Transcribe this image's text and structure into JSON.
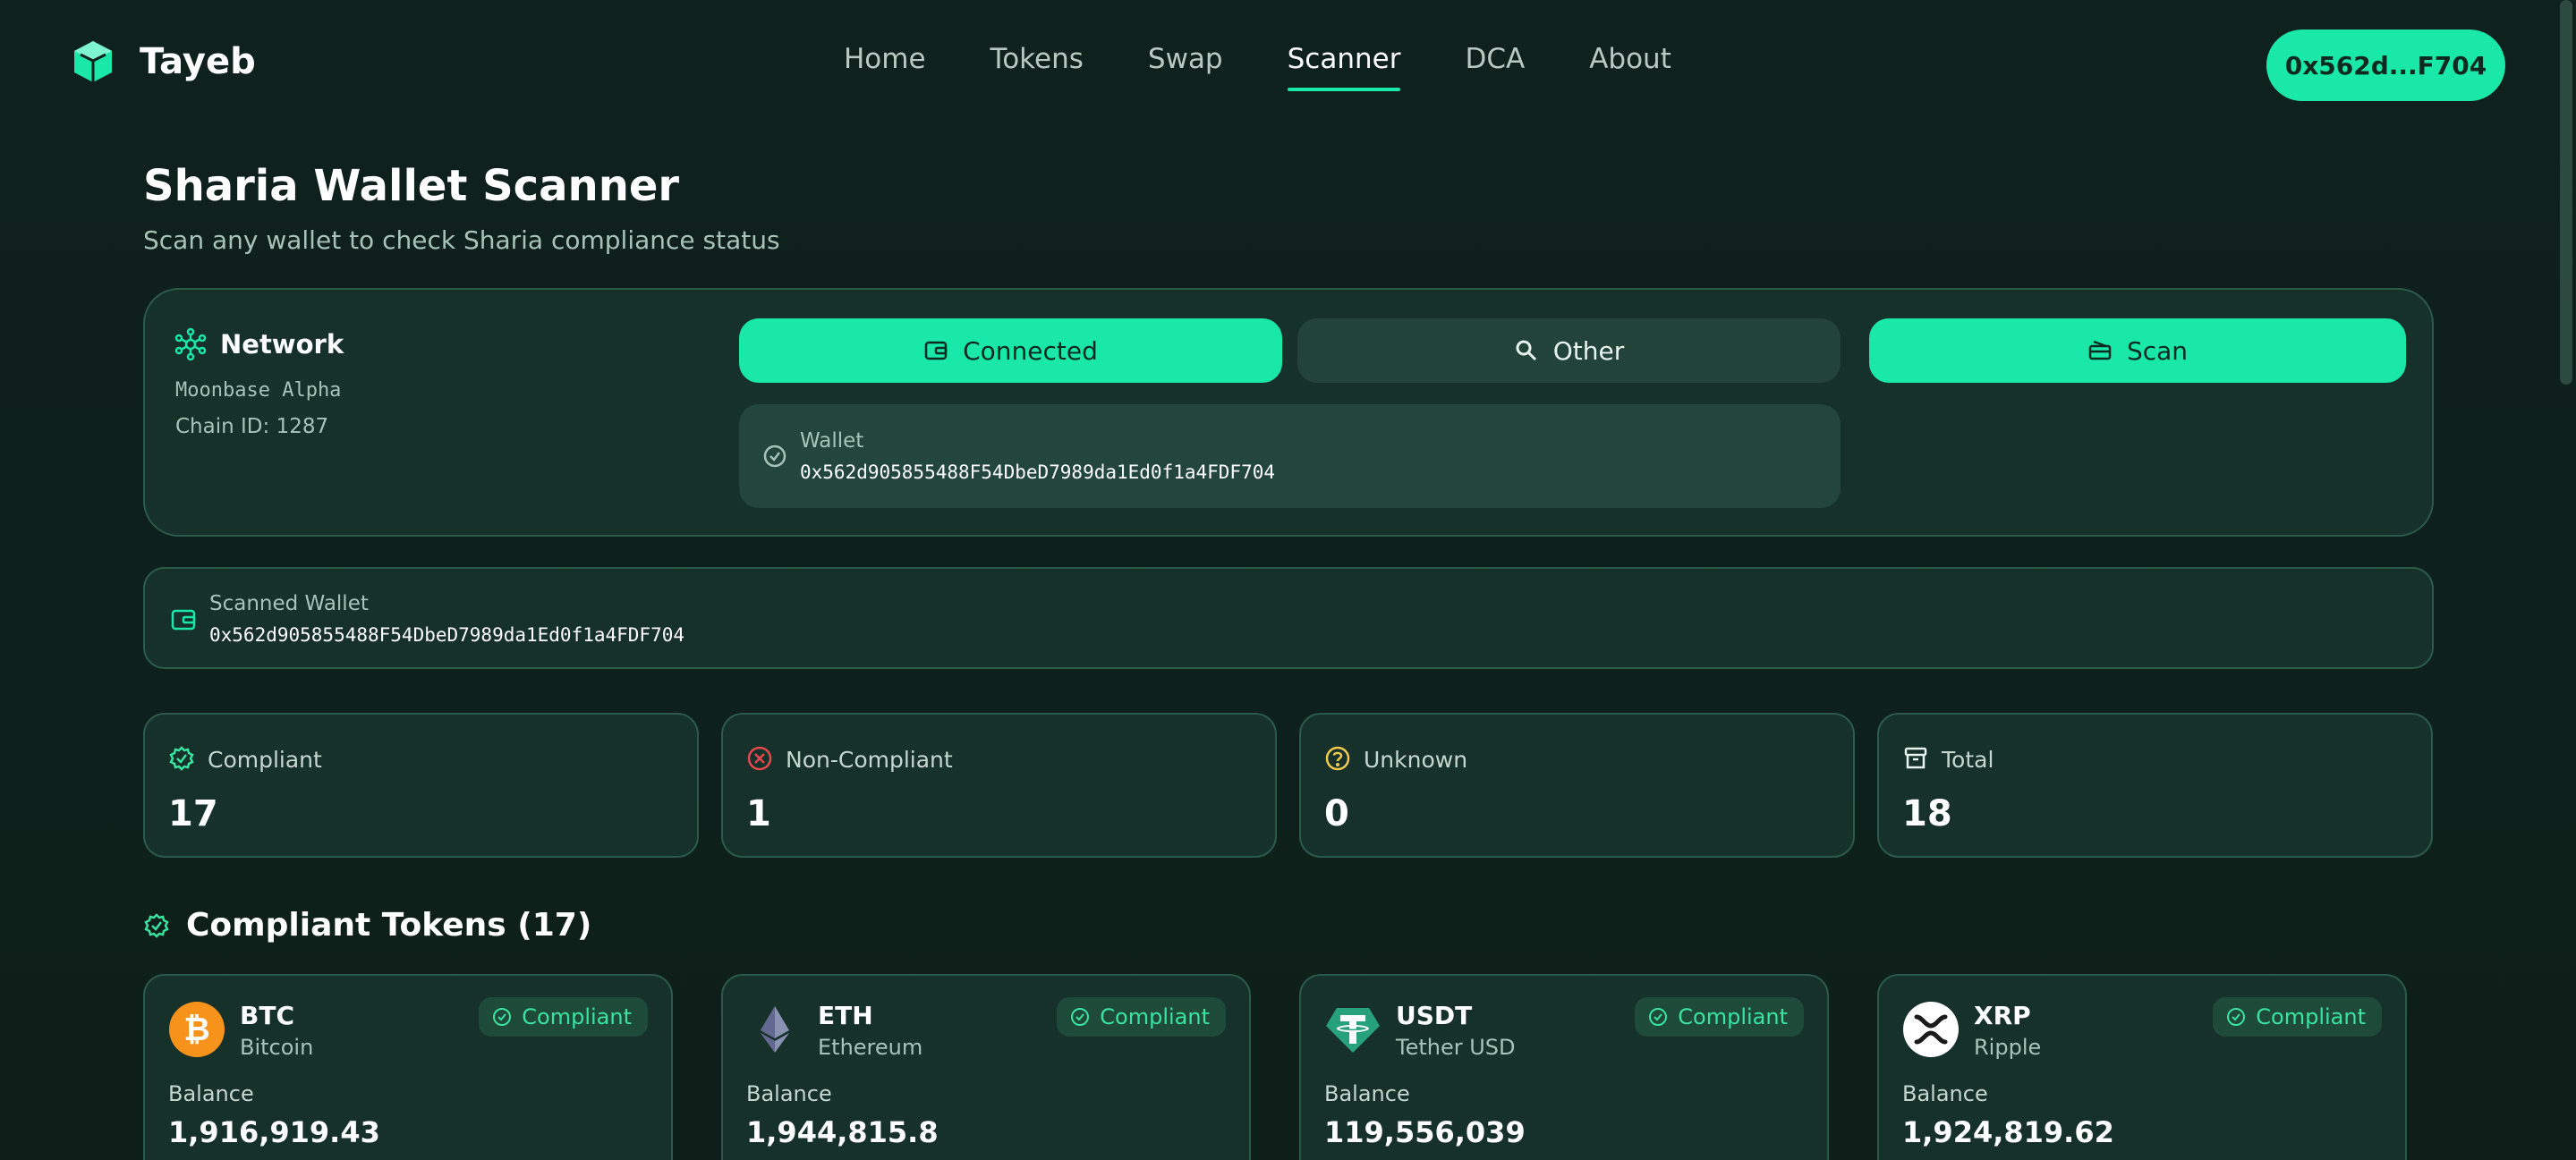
{
  "app": {
    "name": "Tayeb"
  },
  "nav": {
    "items": [
      {
        "label": "Home"
      },
      {
        "label": "Tokens"
      },
      {
        "label": "Swap"
      },
      {
        "label": "Scanner",
        "active": true
      },
      {
        "label": "DCA"
      },
      {
        "label": "About"
      }
    ]
  },
  "wallet_button": {
    "label": "0x562d...F704"
  },
  "page": {
    "title": "Sharia Wallet Scanner",
    "subtitle": "Scan any wallet to check Sharia compliance status"
  },
  "network": {
    "title": "Network",
    "name": "Moonbase Alpha",
    "chain": "Chain ID: 1287"
  },
  "controls": {
    "connected_label": "Connected",
    "other_label": "Other",
    "scan_label": "Scan",
    "wallet_label": "Wallet",
    "wallet_address": "0x562d905855488F54DbeD7989da1Ed0f1a4FDF704"
  },
  "scanned": {
    "label": "Scanned Wallet",
    "address": "0x562d905855488F54DbeD7989da1Ed0f1a4FDF704"
  },
  "stats": [
    {
      "label": "Compliant",
      "value": "17",
      "icon": "check-badge-icon",
      "color": "#39e3a0"
    },
    {
      "label": "Non-Compliant",
      "value": "1",
      "icon": "x-circle-icon",
      "color": "#e5484d"
    },
    {
      "label": "Unknown",
      "value": "0",
      "icon": "question-circle-icon",
      "color": "#f2c94c"
    },
    {
      "label": "Total",
      "value": "18",
      "icon": "archive-icon",
      "color": "#e8f3ee"
    }
  ],
  "section": {
    "title": "Compliant Tokens (17)"
  },
  "tokens": [
    {
      "symbol": "BTC",
      "name": "Bitcoin",
      "badge": "Compliant",
      "balance_label": "Balance",
      "balance": "1,916,919.43",
      "icon": "bitcoin-logo-icon"
    },
    {
      "symbol": "ETH",
      "name": "Ethereum",
      "badge": "Compliant",
      "balance_label": "Balance",
      "balance": "1,944,815.8",
      "icon": "ethereum-logo-icon"
    },
    {
      "symbol": "USDT",
      "name": "Tether USD",
      "badge": "Compliant",
      "balance_label": "Balance",
      "balance": "119,556,039",
      "icon": "tether-logo-icon"
    },
    {
      "symbol": "XRP",
      "name": "Ripple",
      "badge": "Compliant",
      "balance_label": "Balance",
      "balance": "1,924,819.62",
      "icon": "xrp-logo-icon"
    }
  ],
  "colors": {
    "accent": "#19e8a8",
    "background": "#0e201b",
    "card": "#16302a"
  }
}
